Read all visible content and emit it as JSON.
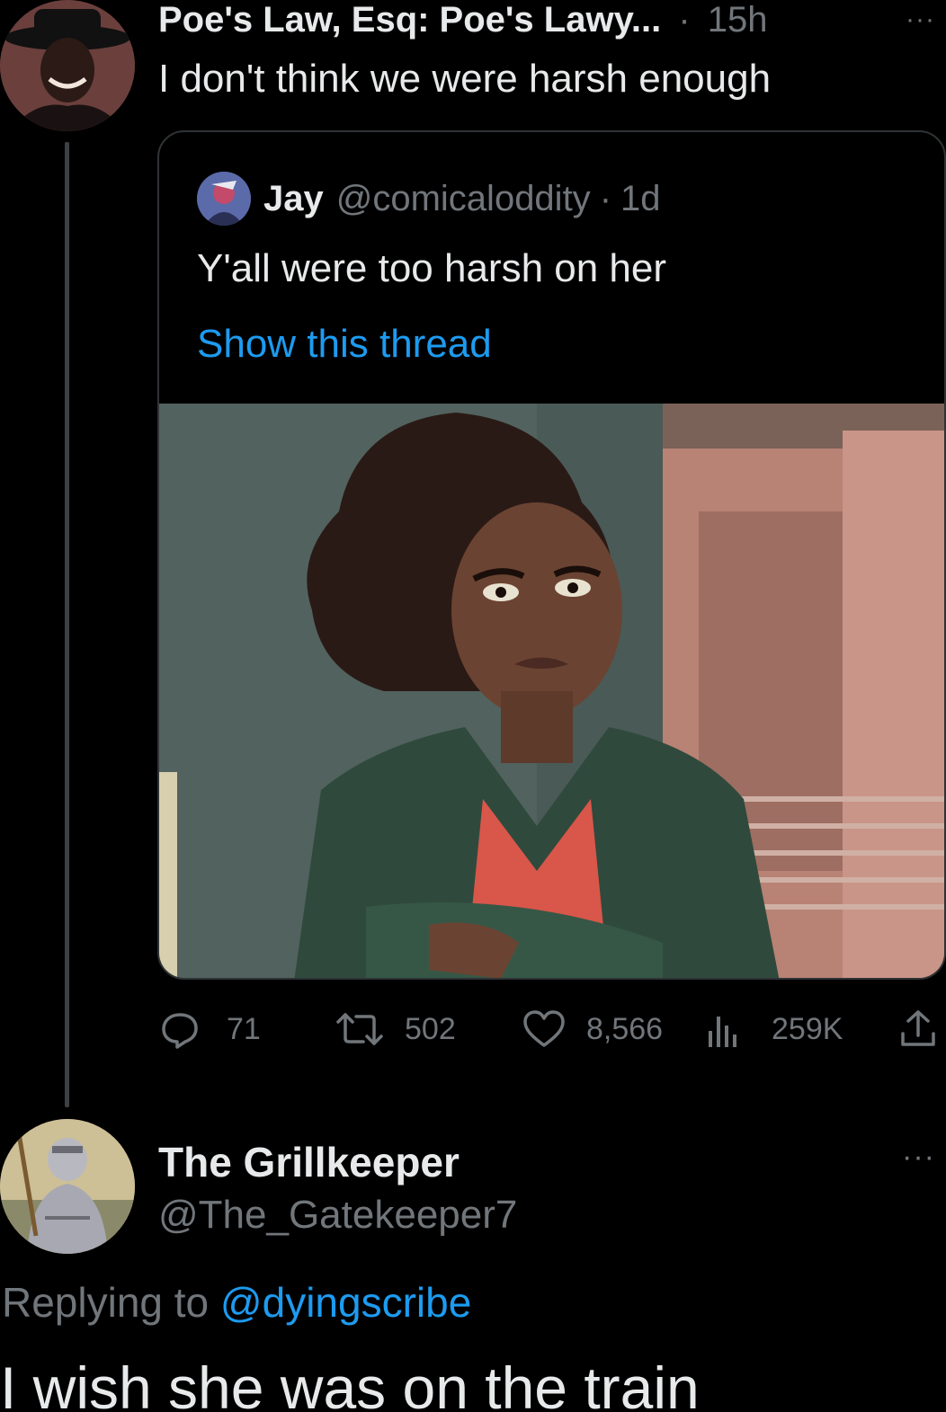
{
  "tweet": {
    "author_name": "Poe's Law, Esq: Poe's Lawy...",
    "separator": "·",
    "time": "15h",
    "more_label": "···",
    "text": "I don't think we were harsh enough"
  },
  "quote": {
    "author_name": "Jay",
    "handle": "@comicaloddity",
    "separator": "·",
    "time": "1d",
    "text": "Y'all were too harsh on her",
    "show_thread": "Show this thread"
  },
  "actions": {
    "replies": "71",
    "retweets": "502",
    "likes": "8,566",
    "views": "259K",
    "icons": [
      "reply-icon",
      "retweet-icon",
      "like-icon",
      "views-icon",
      "share-icon"
    ]
  },
  "reply": {
    "author_name": "The Grillkeeper",
    "handle": "@The_Gatekeeper7",
    "more_label": "···",
    "replying_prefix": "Replying to",
    "replying_to": "@dyingscribe",
    "text": "I wish she was on the train"
  },
  "colors": {
    "background": "#000000",
    "text": "#e7e9ea",
    "muted": "#71767b",
    "link": "#1d9bf0",
    "border": "#2f3336"
  }
}
